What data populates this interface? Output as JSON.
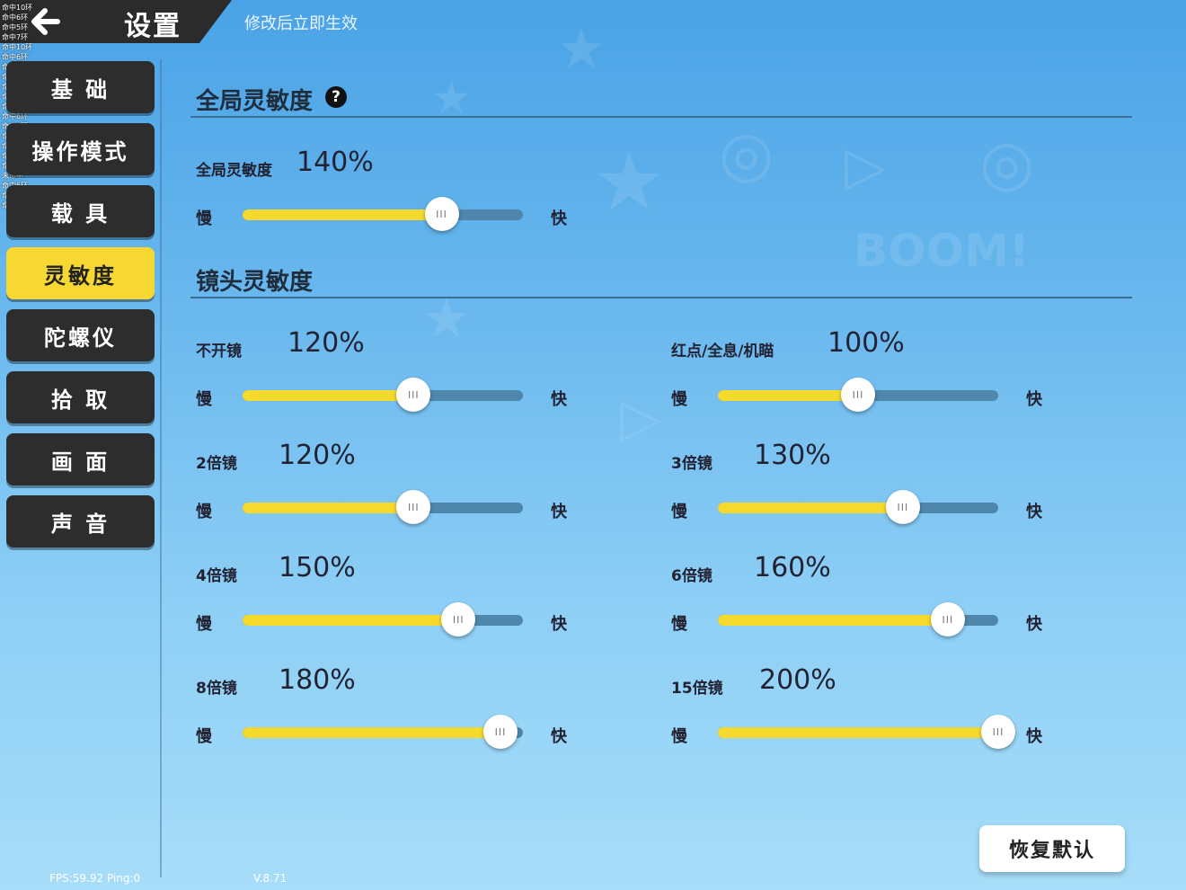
{
  "header": {
    "title": "设置",
    "subtitle": "修改后立即生效",
    "back_icon": "arrow-left-icon",
    "hit_log": [
      "命中10环",
      "命中6环",
      "命中5环",
      "命中7环",
      "命中10环",
      "命中6环",
      "命中6环",
      "命中5环",
      "命中5环",
      "命中7环",
      "命中7环",
      "命中6环",
      "命中5环",
      "命中8环",
      "命中5环",
      "命中5环",
      "命中5环",
      "未命中",
      "命中6环",
      "命中7环",
      "命中8环"
    ]
  },
  "sidebar": {
    "items": [
      {
        "label": "基 础"
      },
      {
        "label": "操作模式"
      },
      {
        "label": "载 具"
      },
      {
        "label": "灵敏度"
      },
      {
        "label": "陀螺仪"
      },
      {
        "label": "拾 取"
      },
      {
        "label": "画 面"
      },
      {
        "label": "声 音"
      }
    ],
    "active_index": 3
  },
  "global": {
    "section_title": "全局灵敏度",
    "help_icon": "question-circle-icon",
    "setting": {
      "label": "全局灵敏度",
      "value": "140%",
      "level": 0.71,
      "slow": "慢",
      "fast": "快"
    }
  },
  "camera": {
    "section_title": "镜头灵敏度",
    "settings": [
      {
        "label": "不开镜",
        "value": "120%",
        "level": 0.61,
        "slow": "慢",
        "fast": "快"
      },
      {
        "label": "红点/全息/机瞄",
        "value": "100%",
        "level": 0.5,
        "slow": "慢",
        "fast": "快"
      },
      {
        "label": "2倍镜",
        "value": "120%",
        "level": 0.61,
        "slow": "慢",
        "fast": "快"
      },
      {
        "label": "3倍镜",
        "value": "130%",
        "level": 0.66,
        "slow": "慢",
        "fast": "快"
      },
      {
        "label": "4倍镜",
        "value": "150%",
        "level": 0.77,
        "slow": "慢",
        "fast": "快"
      },
      {
        "label": "6倍镜",
        "value": "160%",
        "level": 0.82,
        "slow": "慢",
        "fast": "快"
      },
      {
        "label": "8倍镜",
        "value": "180%",
        "level": 0.92,
        "slow": "慢",
        "fast": "快"
      },
      {
        "label": "15倍镜",
        "value": "200%",
        "level": 1.0,
        "slow": "慢",
        "fast": "快"
      }
    ]
  },
  "footer": {
    "reset_label": "恢复默认",
    "fps": "FPS:59.92 Ping:0",
    "version": "V.8.71"
  },
  "colors": {
    "accent": "#f7d731",
    "sidebar_bg": "#2d2d2d",
    "track": "#4f86ab"
  }
}
